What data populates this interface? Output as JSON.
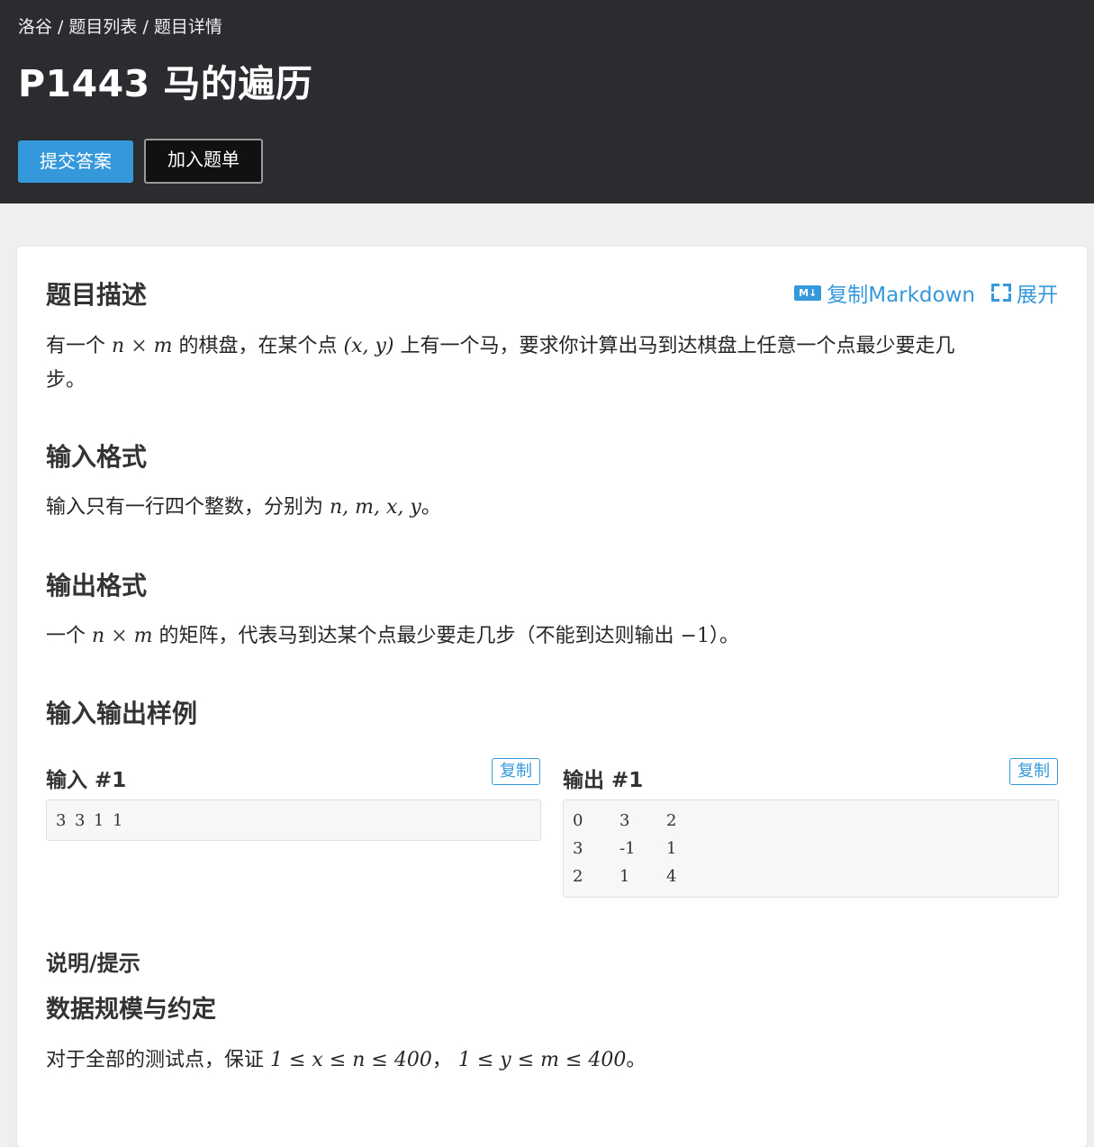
{
  "breadcrumb": {
    "root": "洛谷",
    "list": "题目列表",
    "detail": "题目详情",
    "sep": "/"
  },
  "problem": {
    "title": "P1443 马的遍历"
  },
  "actions": {
    "submit": "提交答案",
    "add_to_list": "加入题单"
  },
  "tools": {
    "copy_markdown": "复制Markdown",
    "expand": "展开",
    "md_icon_text": "M↓"
  },
  "sections": {
    "description_title": "题目描述",
    "description_text_1": "有一个",
    "description_text_2": "的棋盘，在某个点",
    "description_text_3": "上有一个马，要求你计算出马到达棋盘上任意一个点最少要走几",
    "description_text_4": "步。",
    "input_title": "输入格式",
    "input_text_1": "输入只有一行四个整数，分别为",
    "input_text_2": "。",
    "output_title": "输出格式",
    "output_text_1": "一个",
    "output_text_2": "的矩阵，代表马到达某个点最少要走几步（不能到达则输出",
    "output_text_3": "）。",
    "samples_title": "输入输出样例",
    "hint_title": "说明/提示",
    "scale_title": "数据规模与约定",
    "scale_text_1": "对于全部的测试点，保证",
    "scale_text_2": "，",
    "scale_text_3": "。"
  },
  "math": {
    "n": "n",
    "m": "m",
    "x": "x",
    "y": "y",
    "times": "×",
    "point": "(x, y)",
    "vars": "n, m, x, y",
    "neg_one": "−1",
    "cond_x": "1 ≤ x ≤ n ≤ 400",
    "cond_y": "1 ≤ y ≤ m ≤ 400"
  },
  "samples": {
    "input_label": "输入 #1",
    "output_label": "输出 #1",
    "copy": "复制",
    "input_rows": [
      [
        "3",
        "3",
        "1",
        "1"
      ]
    ],
    "output_rows": [
      [
        "0",
        "3",
        "2"
      ],
      [
        "3",
        "-1",
        "1"
      ],
      [
        "2",
        "1",
        "4"
      ]
    ]
  },
  "colors": {
    "accent": "#3498db",
    "header_bg": "#2b2c2f",
    "page_bg": "#efefef"
  }
}
